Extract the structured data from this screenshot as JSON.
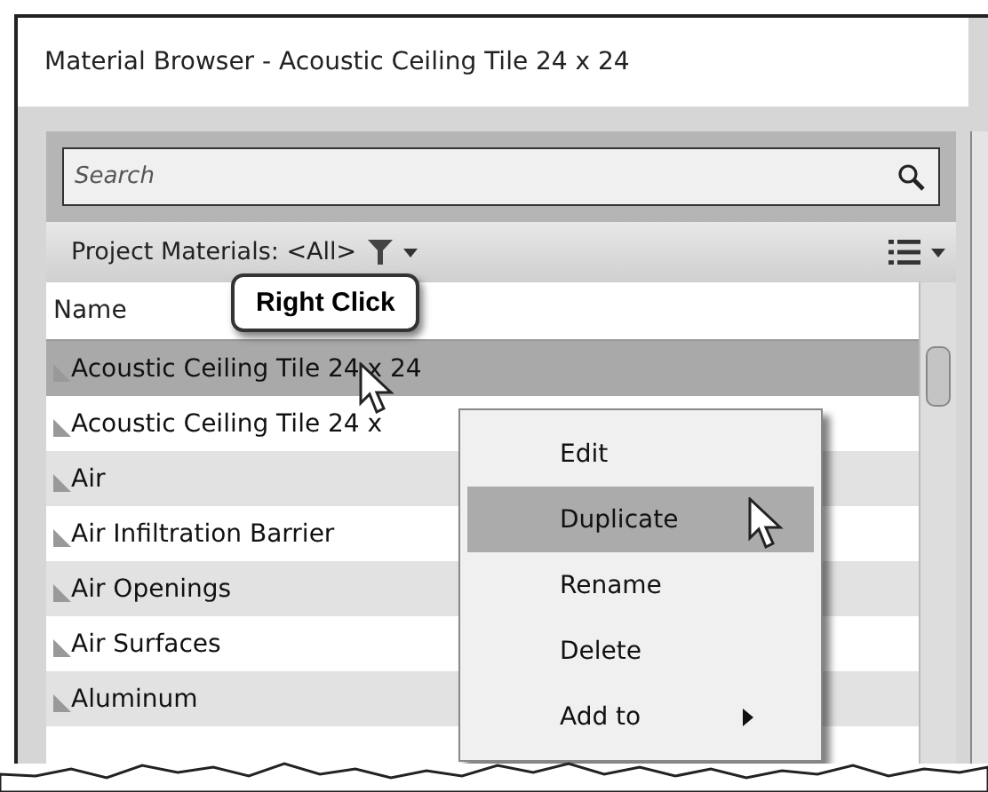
{
  "window": {
    "title": "Material Browser - Acoustic Ceiling Tile 24 x 24"
  },
  "search": {
    "placeholder": "Search"
  },
  "toolbar": {
    "filter_label": "Project Materials: <All>"
  },
  "table": {
    "columns": [
      "Name"
    ],
    "rows": [
      {
        "name": "Acoustic Ceiling Tile 24 x 24",
        "selected": true
      },
      {
        "name": "Acoustic Ceiling Tile 24 x",
        "selected": false
      },
      {
        "name": "Air",
        "selected": false
      },
      {
        "name": "Air Infiltration Barrier",
        "selected": false
      },
      {
        "name": "Air Openings",
        "selected": false
      },
      {
        "name": "Air Surfaces",
        "selected": false
      },
      {
        "name": "Aluminum",
        "selected": false
      }
    ]
  },
  "callout": {
    "text": "Right Click"
  },
  "context_menu": {
    "items": [
      {
        "label": "Edit",
        "selected": false,
        "submenu": false
      },
      {
        "label": "Duplicate",
        "selected": true,
        "submenu": false
      },
      {
        "label": "Rename",
        "selected": false,
        "submenu": false
      },
      {
        "label": "Delete",
        "selected": false,
        "submenu": false
      },
      {
        "label": "Add to",
        "selected": false,
        "submenu": true
      }
    ]
  }
}
